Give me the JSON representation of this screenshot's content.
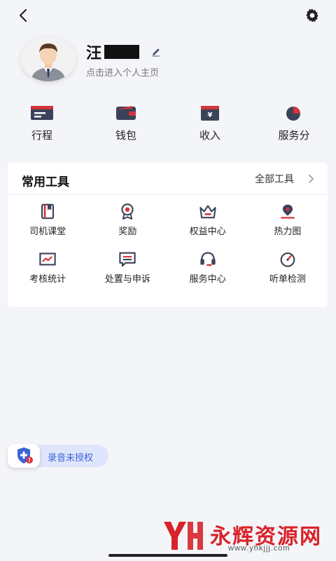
{
  "header": {
    "back_icon": "chevron-left-icon",
    "settings_icon": "gear-icon"
  },
  "profile": {
    "name": "汪",
    "subtitle": "点击进入个人主页",
    "edit_icon": "pencil-icon"
  },
  "quick_actions": [
    {
      "label": "行程",
      "icon": "itinerary-icon"
    },
    {
      "label": "钱包",
      "icon": "wallet-icon"
    },
    {
      "label": "收入",
      "icon": "income-icon"
    },
    {
      "label": "服务分",
      "icon": "pie-chart-icon"
    }
  ],
  "tools": {
    "title": "常用工具",
    "all_label": "全部工具",
    "items": [
      {
        "label": "司机课堂",
        "icon": "book-icon"
      },
      {
        "label": "奖励",
        "icon": "medal-icon"
      },
      {
        "label": "权益中心",
        "icon": "crown-icon"
      },
      {
        "label": "热力图",
        "icon": "map-pin-icon"
      },
      {
        "label": "考核统计",
        "icon": "stats-chart-icon"
      },
      {
        "label": "处置与申诉",
        "icon": "message-icon"
      },
      {
        "label": "服务中心",
        "icon": "headset-icon"
      },
      {
        "label": "听单检测",
        "icon": "gauge-icon"
      }
    ]
  },
  "recording": {
    "label": "录音未授权",
    "icon": "shield-alert-icon"
  },
  "watermark": {
    "title": "永辉资源网",
    "url": "www.yhkjjj.com"
  },
  "colors": {
    "accent_red": "#d4343b",
    "icon_dark": "#3a4358",
    "link_blue": "#3b63d8"
  }
}
